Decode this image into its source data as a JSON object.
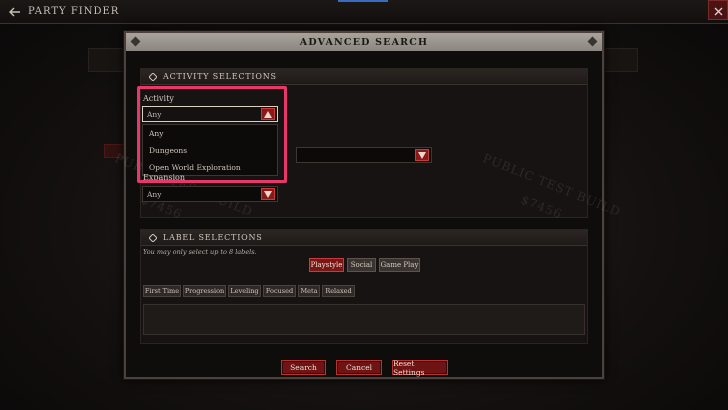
{
  "topbar": {
    "title": "PARTY FINDER",
    "back_icon": "back-arrow-icon",
    "close_icon": "close-icon"
  },
  "modal": {
    "title": "ADVANCED SEARCH"
  },
  "activity_section": {
    "title": "ACTIVITY SELECTIONS",
    "activity_label": "Activity",
    "activity_value": "Any",
    "activity_options": [
      "Any",
      "Dungeons",
      "Open World Exploration"
    ],
    "expansion_label": "Expansion",
    "expansion_value": "Any"
  },
  "watermark": {
    "line1": "PUBLIC TEST BUILD",
    "line2": "$7456"
  },
  "label_section": {
    "title": "LABEL SELECTIONS",
    "help_text": "You may only select up to 8 labels.",
    "tabs": [
      "Playstyle",
      "Social",
      "Game Play"
    ],
    "active_tab": "Playstyle",
    "chips": [
      "First Time",
      "Progression",
      "Leveling",
      "Focused",
      "Meta",
      "Relaxed"
    ]
  },
  "footer": {
    "search": "Search",
    "cancel": "Cancel",
    "reset": "Reset Settings"
  },
  "colors": {
    "accent_red": "#8a1a1a",
    "highlight_pink": "#e8386b"
  }
}
